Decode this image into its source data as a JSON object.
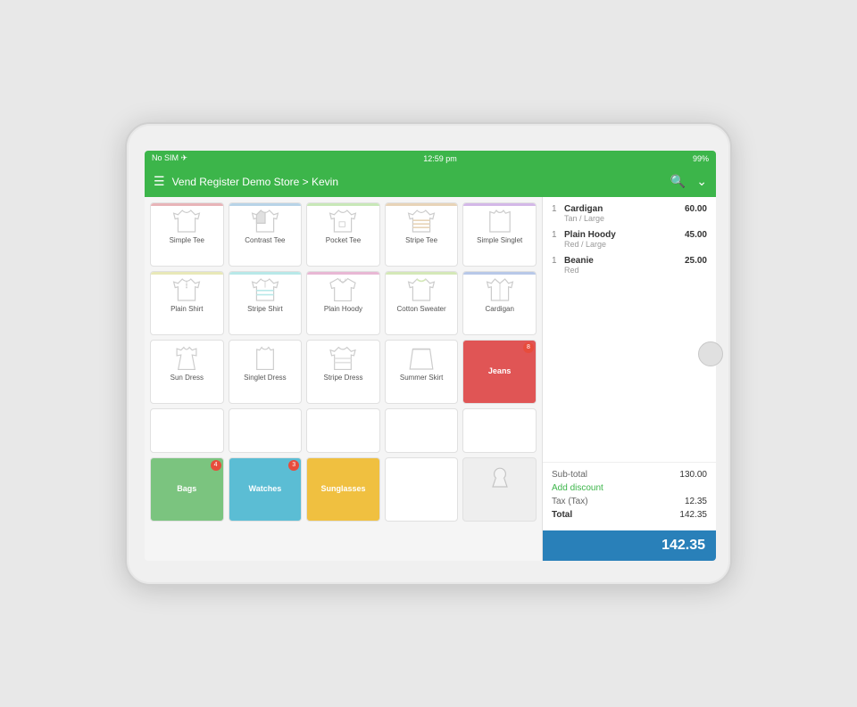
{
  "status_bar": {
    "signal": "No SIM ✈",
    "time": "12:59 pm",
    "battery": "99%"
  },
  "nav_bar": {
    "title": "Vend Register Demo Store > Kevin"
  },
  "products": {
    "row1": [
      {
        "id": "simple-tee",
        "label": "Simple Tee",
        "color_bar": "#e8b4b8",
        "type": "clothing"
      },
      {
        "id": "contrast-tee",
        "label": "Contrast Tee",
        "color_bar": "#b8d4e8",
        "type": "clothing"
      },
      {
        "id": "pocket-tee",
        "label": "Pocket Tee",
        "color_bar": "#c8e8b8",
        "type": "clothing"
      },
      {
        "id": "stripe-tee",
        "label": "Stripe Tee",
        "color_bar": "#e8d4b8",
        "type": "clothing"
      },
      {
        "id": "simple-singlet",
        "label": "Simple Singlet",
        "color_bar": "#d4b8e8",
        "type": "clothing"
      }
    ],
    "row2": [
      {
        "id": "plain-shirt",
        "label": "Plain Shirt",
        "color_bar": "#e8e8b8",
        "type": "clothing"
      },
      {
        "id": "stripe-shirt",
        "label": "Stripe Shirt",
        "color_bar": "#b8e8e8",
        "type": "clothing"
      },
      {
        "id": "plain-hoody",
        "label": "Plain Hoody",
        "color_bar": "#e8b8d4",
        "type": "clothing"
      },
      {
        "id": "cotton-sweater",
        "label": "Cotton Sweater",
        "color_bar": "#d4e8b8",
        "type": "clothing"
      },
      {
        "id": "cardigan",
        "label": "Cardigan",
        "color_bar": "#b8c8e8",
        "type": "clothing"
      }
    ],
    "row3": [
      {
        "id": "sun-dress",
        "label": "Sun Dress",
        "color_bar": "",
        "type": "clothing"
      },
      {
        "id": "singlet-dress",
        "label": "Singlet Dress",
        "color_bar": "",
        "type": "clothing"
      },
      {
        "id": "stripe-dress",
        "label": "Stripe Dress",
        "color_bar": "",
        "type": "clothing"
      },
      {
        "id": "summer-skirt",
        "label": "Summer Skirt",
        "color_bar": "",
        "type": "clothing"
      },
      {
        "id": "jeans",
        "label": "Jeans",
        "color_bar": "",
        "type": "colored",
        "bg": "#e05555",
        "badge": "8"
      }
    ],
    "row4": [
      {
        "id": "empty1",
        "label": "",
        "type": "empty"
      },
      {
        "id": "empty2",
        "label": "",
        "type": "empty"
      },
      {
        "id": "empty3",
        "label": "",
        "type": "empty"
      },
      {
        "id": "empty4",
        "label": "",
        "type": "empty"
      },
      {
        "id": "empty5",
        "label": "",
        "type": "empty"
      }
    ],
    "row5": [
      {
        "id": "bags",
        "label": "Bags",
        "type": "colored",
        "bg": "#7bc47f",
        "badge": "4"
      },
      {
        "id": "watches",
        "label": "Watches",
        "type": "colored",
        "bg": "#5bbdd4",
        "badge": "3"
      },
      {
        "id": "sunglasses",
        "label": "Sunglasses",
        "type": "colored",
        "bg": "#f0c040",
        "badge": ""
      },
      {
        "id": "col4",
        "label": "",
        "type": "empty"
      },
      {
        "id": "col5",
        "label": "",
        "type": "empty"
      }
    ]
  },
  "cart": {
    "items": [
      {
        "qty": "1",
        "name": "Cardigan",
        "variant": "Tan / Large",
        "price": "60.00"
      },
      {
        "qty": "1",
        "name": "Plain Hoody",
        "variant": "Red / Large",
        "price": "45.00"
      },
      {
        "qty": "1",
        "name": "Beanie",
        "variant": "Red",
        "price": "25.00"
      }
    ],
    "subtotal_label": "Sub-total",
    "subtotal_value": "130.00",
    "add_discount_label": "Add discount",
    "tax_label": "Tax (Tax)",
    "tax_value": "12.35",
    "total_label": "Total",
    "total_value": "142.35",
    "checkout_amount": "142.35"
  }
}
